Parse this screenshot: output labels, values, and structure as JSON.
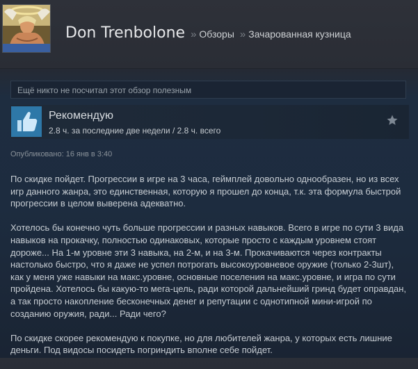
{
  "header": {
    "user_name": "Don Trenbolone",
    "breadcrumb_sep": "»",
    "breadcrumb": [
      "Обзоры",
      "Зачарованная кузница"
    ]
  },
  "helpful_text": "Ещё никто не посчитал этот обзор полезным",
  "recommendation": {
    "label": "Рекомендую",
    "hours": "2.8 ч. за последние две недели / 2.8 ч. всего"
  },
  "posted": "Опубликовано: 16 янв в 3:40",
  "review_paragraphs": [
    "По скидке пойдет. Прогрессии в игре на 3 часа, геймплей довольно однообразен, но из всех игр данного жанра, это единственная, которую я прошел до конца, т.к. эта формула быстрой прогрессии в целом выверена адекватно.",
    "Хотелось бы конечно чуть больше прогрессии и разных навыков. Всего в игре по сути 3 вида навыков на прокачку, полностью одинаковых, которые просто с каждым уровнем стоят дороже... На 1-м уровне эти 3 навыка, на 2-м, и на 3-м. Прокачиваются через контракты настолько быстро, что я даже не успел потрогать высокоуровневое оружие (только 2-3шт), как у меня уже навыки на макс.уровне, основные поселения на макс.уровне, и игра по сути пройдена. Хотелось бы какую-то мега-цель, ради которой дальнейший гринд будет оправдан, а так просто накопление бесконечных денег и репутации с однотипной мини-игрой по созданию оружия, ради... Ради чего?",
    "По скидке скорее рекомендую к покупке, но для любителей жанра, у которых есть лишние деньги. Под видосы посидеть погриндить вполне себе пойдет."
  ],
  "icons": {
    "avatar": "user-avatar-image",
    "thumb": "thumbs-up-icon",
    "star": "star-icon"
  },
  "colors": {
    "thumb_bg": "#2e78a8",
    "background": "#1d2c3f"
  }
}
